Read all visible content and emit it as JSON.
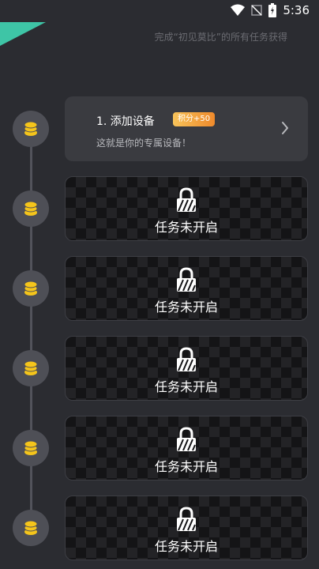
{
  "status_bar": {
    "time": "5:36",
    "icons": [
      "wifi-icon",
      "no-signal-icon",
      "battery-charging-icon"
    ]
  },
  "header": {
    "subtitle": "完成“初见莫比”的所有任务获得"
  },
  "colors": {
    "accent": "#3ec5a6",
    "coin": "#f5c51b",
    "badge_start": "#f7c35a",
    "badge_end": "#ef8a2c"
  },
  "tasks": [
    {
      "title": "1. 添加设备",
      "badge": "积分+50",
      "description": "这就是你的专属设备！",
      "locked": false
    },
    {
      "locked_label": "任务未开启",
      "locked": true
    },
    {
      "locked_label": "任务未开启",
      "locked": true
    },
    {
      "locked_label": "任务未开启",
      "locked": true
    },
    {
      "locked_label": "任务未开启",
      "locked": true
    },
    {
      "locked_label": "任务未开启",
      "locked": true
    }
  ]
}
